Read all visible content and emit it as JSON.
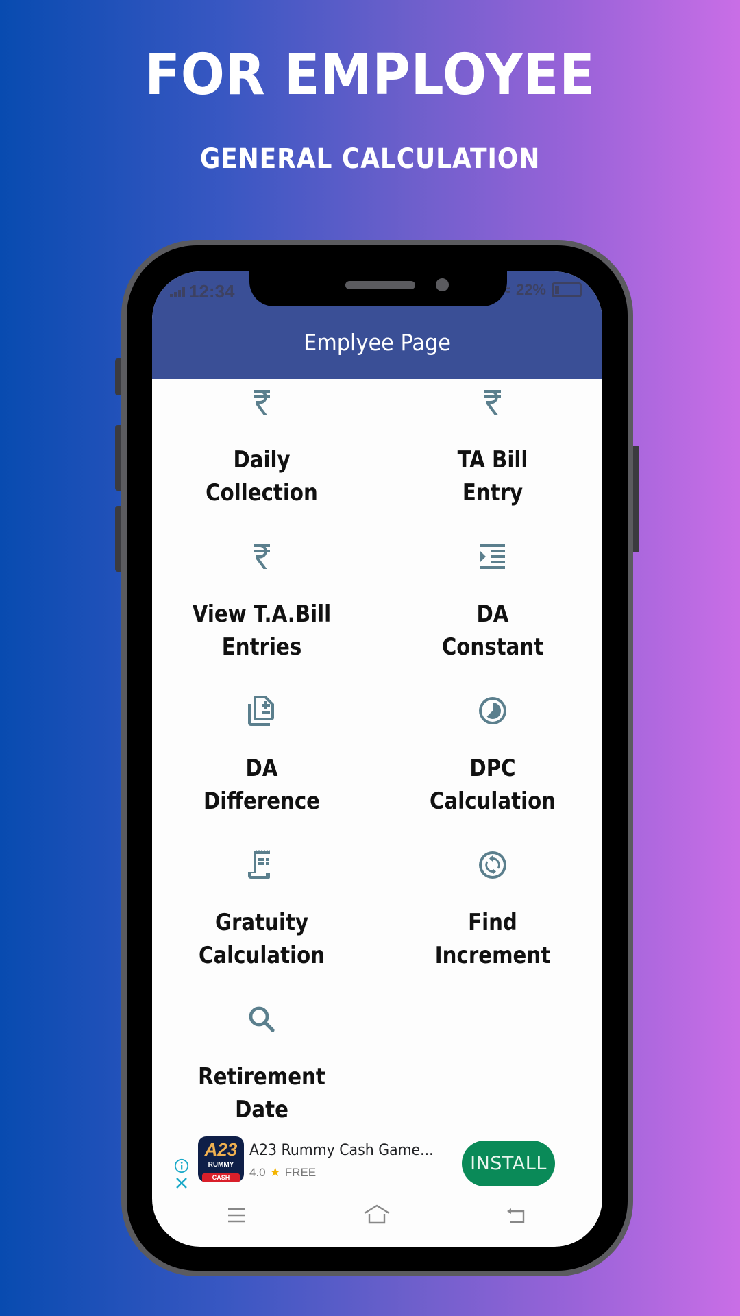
{
  "promo": {
    "headline": "FOR EMPLOYEE",
    "subheadline": "GENERAL CALCULATION"
  },
  "status_bar": {
    "time": "12:34",
    "battery": "22%"
  },
  "app_bar": {
    "title": "Emplyee Page"
  },
  "colors": {
    "app_bar": "#3a4f96",
    "icon": "#5b7f8d",
    "install_button": "#0a8a58"
  },
  "menu": [
    {
      "icon": "rupee-icon",
      "line1": "Daily",
      "line2": "Collection"
    },
    {
      "icon": "rupee-icon",
      "line1": "TA Bill",
      "line2": "Entry"
    },
    {
      "icon": "rupee-icon",
      "line1": "View T.A.Bill",
      "line2": "Entries"
    },
    {
      "icon": "format-indent-icon",
      "line1": "DA",
      "line2": "Constant"
    },
    {
      "icon": "difference-icon",
      "line1": "DA",
      "line2": "Difference"
    },
    {
      "icon": "pie-timer-icon",
      "line1": "DPC",
      "line2": "Calculation"
    },
    {
      "icon": "receipt-icon",
      "line1": "Gratuity",
      "line2": "Calculation"
    },
    {
      "icon": "sync-circle-icon",
      "line1": "Find",
      "line2": "Increment"
    },
    {
      "icon": "search-icon",
      "line1": "Retirement",
      "line2": "Date"
    }
  ],
  "ad": {
    "app_icon_text": "A23",
    "app_icon_sub": "RUMMY",
    "app_icon_badge": "CASH",
    "title": "A23 Rummy Cash Game...",
    "rating": "4.0",
    "price": "FREE",
    "install_label": "INSTALL"
  },
  "nav_bar": {
    "items": [
      "menu",
      "home",
      "back"
    ]
  }
}
